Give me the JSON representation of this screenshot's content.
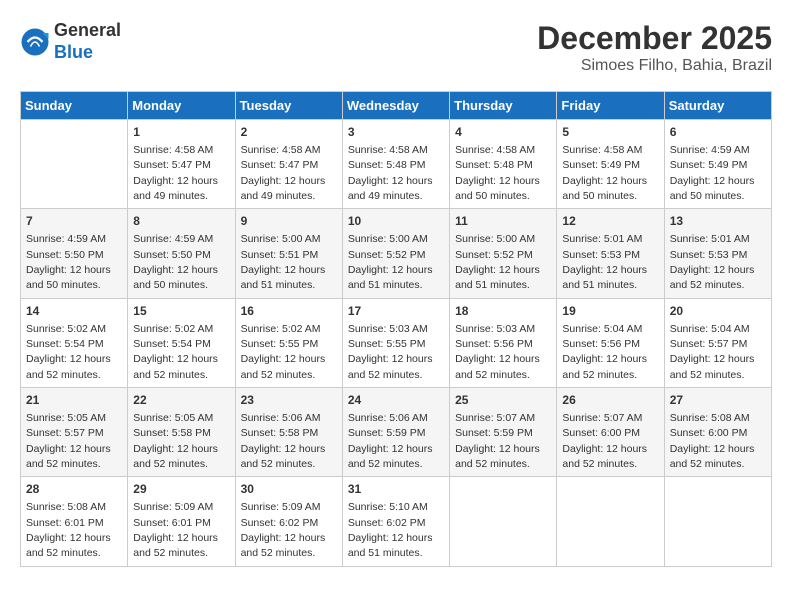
{
  "header": {
    "logo": {
      "general": "General",
      "blue": "Blue"
    },
    "title": "December 2025",
    "location": "Simoes Filho, Bahia, Brazil"
  },
  "weekdays": [
    "Sunday",
    "Monday",
    "Tuesday",
    "Wednesday",
    "Thursday",
    "Friday",
    "Saturday"
  ],
  "weeks": [
    [
      {
        "day": "",
        "sunrise": "",
        "sunset": "",
        "daylight": ""
      },
      {
        "day": "1",
        "sunrise": "Sunrise: 4:58 AM",
        "sunset": "Sunset: 5:47 PM",
        "daylight": "Daylight: 12 hours and 49 minutes."
      },
      {
        "day": "2",
        "sunrise": "Sunrise: 4:58 AM",
        "sunset": "Sunset: 5:47 PM",
        "daylight": "Daylight: 12 hours and 49 minutes."
      },
      {
        "day": "3",
        "sunrise": "Sunrise: 4:58 AM",
        "sunset": "Sunset: 5:48 PM",
        "daylight": "Daylight: 12 hours and 49 minutes."
      },
      {
        "day": "4",
        "sunrise": "Sunrise: 4:58 AM",
        "sunset": "Sunset: 5:48 PM",
        "daylight": "Daylight: 12 hours and 50 minutes."
      },
      {
        "day": "5",
        "sunrise": "Sunrise: 4:58 AM",
        "sunset": "Sunset: 5:49 PM",
        "daylight": "Daylight: 12 hours and 50 minutes."
      },
      {
        "day": "6",
        "sunrise": "Sunrise: 4:59 AM",
        "sunset": "Sunset: 5:49 PM",
        "daylight": "Daylight: 12 hours and 50 minutes."
      }
    ],
    [
      {
        "day": "7",
        "sunrise": "Sunrise: 4:59 AM",
        "sunset": "Sunset: 5:50 PM",
        "daylight": "Daylight: 12 hours and 50 minutes."
      },
      {
        "day": "8",
        "sunrise": "Sunrise: 4:59 AM",
        "sunset": "Sunset: 5:50 PM",
        "daylight": "Daylight: 12 hours and 50 minutes."
      },
      {
        "day": "9",
        "sunrise": "Sunrise: 5:00 AM",
        "sunset": "Sunset: 5:51 PM",
        "daylight": "Daylight: 12 hours and 51 minutes."
      },
      {
        "day": "10",
        "sunrise": "Sunrise: 5:00 AM",
        "sunset": "Sunset: 5:52 PM",
        "daylight": "Daylight: 12 hours and 51 minutes."
      },
      {
        "day": "11",
        "sunrise": "Sunrise: 5:00 AM",
        "sunset": "Sunset: 5:52 PM",
        "daylight": "Daylight: 12 hours and 51 minutes."
      },
      {
        "day": "12",
        "sunrise": "Sunrise: 5:01 AM",
        "sunset": "Sunset: 5:53 PM",
        "daylight": "Daylight: 12 hours and 51 minutes."
      },
      {
        "day": "13",
        "sunrise": "Sunrise: 5:01 AM",
        "sunset": "Sunset: 5:53 PM",
        "daylight": "Daylight: 12 hours and 52 minutes."
      }
    ],
    [
      {
        "day": "14",
        "sunrise": "Sunrise: 5:02 AM",
        "sunset": "Sunset: 5:54 PM",
        "daylight": "Daylight: 12 hours and 52 minutes."
      },
      {
        "day": "15",
        "sunrise": "Sunrise: 5:02 AM",
        "sunset": "Sunset: 5:54 PM",
        "daylight": "Daylight: 12 hours and 52 minutes."
      },
      {
        "day": "16",
        "sunrise": "Sunrise: 5:02 AM",
        "sunset": "Sunset: 5:55 PM",
        "daylight": "Daylight: 12 hours and 52 minutes."
      },
      {
        "day": "17",
        "sunrise": "Sunrise: 5:03 AM",
        "sunset": "Sunset: 5:55 PM",
        "daylight": "Daylight: 12 hours and 52 minutes."
      },
      {
        "day": "18",
        "sunrise": "Sunrise: 5:03 AM",
        "sunset": "Sunset: 5:56 PM",
        "daylight": "Daylight: 12 hours and 52 minutes."
      },
      {
        "day": "19",
        "sunrise": "Sunrise: 5:04 AM",
        "sunset": "Sunset: 5:56 PM",
        "daylight": "Daylight: 12 hours and 52 minutes."
      },
      {
        "day": "20",
        "sunrise": "Sunrise: 5:04 AM",
        "sunset": "Sunset: 5:57 PM",
        "daylight": "Daylight: 12 hours and 52 minutes."
      }
    ],
    [
      {
        "day": "21",
        "sunrise": "Sunrise: 5:05 AM",
        "sunset": "Sunset: 5:57 PM",
        "daylight": "Daylight: 12 hours and 52 minutes."
      },
      {
        "day": "22",
        "sunrise": "Sunrise: 5:05 AM",
        "sunset": "Sunset: 5:58 PM",
        "daylight": "Daylight: 12 hours and 52 minutes."
      },
      {
        "day": "23",
        "sunrise": "Sunrise: 5:06 AM",
        "sunset": "Sunset: 5:58 PM",
        "daylight": "Daylight: 12 hours and 52 minutes."
      },
      {
        "day": "24",
        "sunrise": "Sunrise: 5:06 AM",
        "sunset": "Sunset: 5:59 PM",
        "daylight": "Daylight: 12 hours and 52 minutes."
      },
      {
        "day": "25",
        "sunrise": "Sunrise: 5:07 AM",
        "sunset": "Sunset: 5:59 PM",
        "daylight": "Daylight: 12 hours and 52 minutes."
      },
      {
        "day": "26",
        "sunrise": "Sunrise: 5:07 AM",
        "sunset": "Sunset: 6:00 PM",
        "daylight": "Daylight: 12 hours and 52 minutes."
      },
      {
        "day": "27",
        "sunrise": "Sunrise: 5:08 AM",
        "sunset": "Sunset: 6:00 PM",
        "daylight": "Daylight: 12 hours and 52 minutes."
      }
    ],
    [
      {
        "day": "28",
        "sunrise": "Sunrise: 5:08 AM",
        "sunset": "Sunset: 6:01 PM",
        "daylight": "Daylight: 12 hours and 52 minutes."
      },
      {
        "day": "29",
        "sunrise": "Sunrise: 5:09 AM",
        "sunset": "Sunset: 6:01 PM",
        "daylight": "Daylight: 12 hours and 52 minutes."
      },
      {
        "day": "30",
        "sunrise": "Sunrise: 5:09 AM",
        "sunset": "Sunset: 6:02 PM",
        "daylight": "Daylight: 12 hours and 52 minutes."
      },
      {
        "day": "31",
        "sunrise": "Sunrise: 5:10 AM",
        "sunset": "Sunset: 6:02 PM",
        "daylight": "Daylight: 12 hours and 51 minutes."
      },
      {
        "day": "",
        "sunrise": "",
        "sunset": "",
        "daylight": ""
      },
      {
        "day": "",
        "sunrise": "",
        "sunset": "",
        "daylight": ""
      },
      {
        "day": "",
        "sunrise": "",
        "sunset": "",
        "daylight": ""
      }
    ]
  ]
}
